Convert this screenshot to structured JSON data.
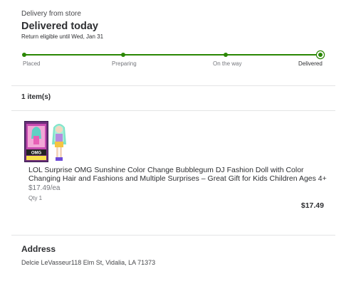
{
  "delivery": {
    "type": "Delivery from store",
    "status": "Delivered today",
    "return_note": "Return eligible until Wed, Jan 31"
  },
  "tracker": {
    "stages": [
      {
        "label": "Placed",
        "completed": true
      },
      {
        "label": "Preparing",
        "completed": true
      },
      {
        "label": "On the way",
        "completed": true
      },
      {
        "label": "Delivered",
        "completed": true,
        "current": true
      }
    ],
    "progress": 1.0,
    "color": "#2a8703"
  },
  "items": {
    "count_label": "1 item(s)",
    "list": [
      {
        "title": "LOL Surprise OMG Sunshine Color Change Bubblegum DJ Fashion Doll with Color Changing Hair and Fashions and Multiple Surprises – Great Gift for Kids Children Ages 4+",
        "unit_price": "$17.49/ea",
        "quantity": "Qty 1",
        "total": "$17.49",
        "image_icon": "doll-product-image"
      }
    ]
  },
  "address": {
    "heading": "Address",
    "text": "Delcie LeVasseur118 Elm St, Vidalia, LA 71373"
  }
}
